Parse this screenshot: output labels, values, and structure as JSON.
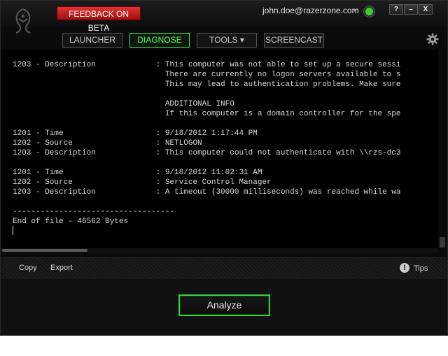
{
  "titlebar": {
    "feedback_label": "FEEDBACK ON BETA",
    "user_email": "john.doe@razerzone.com",
    "help_label": "?",
    "minimize_label": "–",
    "close_label": "X"
  },
  "nav": {
    "launcher": "LAUNCHER",
    "diagnose": "DIAGNOSE",
    "tools": "TOOLS ▾",
    "screencast": "SCREENCAST"
  },
  "log": {
    "lines": [
      "1203 - Description             : This computer was not able to set up a secure sessi",
      "                                 There are currently no logon servers available to s",
      "                                 This may lead to authentication problems. Make sure",
      "",
      "                                 ADDITIONAL INFO",
      "                                 If this computer is a domain controller for the spe",
      "",
      "1201 - Time                    : 9/18/2012 1:17:44 PM",
      "1202 - Source                  : NETLOGON",
      "1203 - Description             : This computer could not authenticate with \\\\rzs-dc3",
      "",
      "1201 - Time                    : 9/18/2012 11:02:31 AM",
      "1202 - Source                  : Service Control Manager",
      "1203 - Description             : A timeout (30000 milliseconds) was reached while wa",
      "",
      "-----------------------------------",
      "End of file - 46562 Bytes"
    ]
  },
  "actions": {
    "copy": "Copy",
    "export": "Export",
    "tips": "Tips"
  },
  "analyze_label": "Analyze",
  "colors": {
    "accent_green": "#3ccd3c",
    "feedback_red": "#cc2222"
  }
}
